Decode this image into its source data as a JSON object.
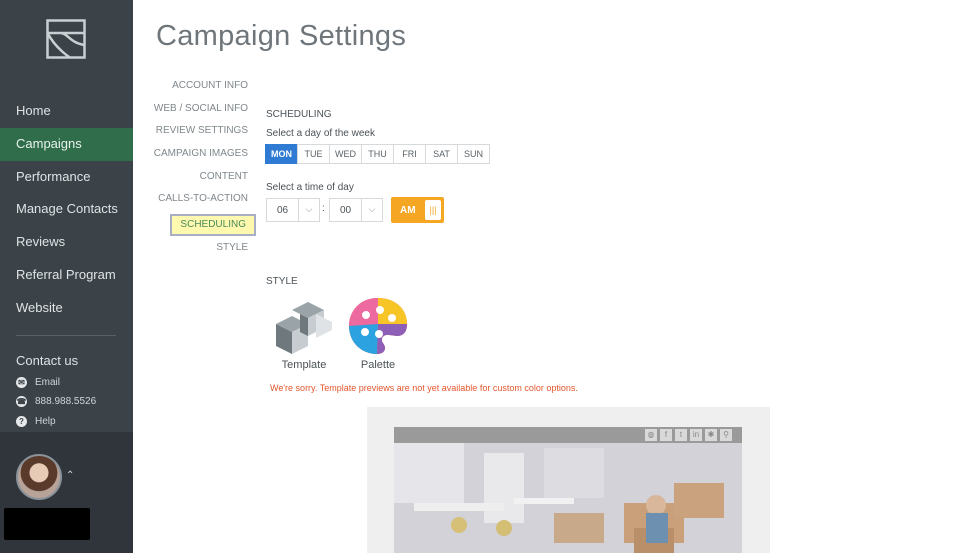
{
  "sidebar": {
    "nav": [
      {
        "label": "Home",
        "active": false
      },
      {
        "label": "Campaigns",
        "active": true
      },
      {
        "label": "Performance",
        "active": false
      },
      {
        "label": "Manage Contacts",
        "active": false
      },
      {
        "label": "Reviews",
        "active": false
      },
      {
        "label": "Referral Program",
        "active": false
      },
      {
        "label": "Website",
        "active": false
      }
    ],
    "contact_title": "Contact us",
    "email": "Email",
    "phone": "888.988.5526",
    "help": "Help"
  },
  "page": {
    "title": "Campaign Settings"
  },
  "subnav": [
    {
      "label": "ACCOUNT INFO"
    },
    {
      "label": "WEB / SOCIAL INFO"
    },
    {
      "label": "REVIEW SETTINGS"
    },
    {
      "label": "CAMPAIGN IMAGES"
    },
    {
      "label": "CONTENT"
    },
    {
      "label": "CALLS-TO-ACTION"
    },
    {
      "label": "SCHEDULING",
      "active": true
    },
    {
      "label": "STYLE"
    }
  ],
  "scheduling": {
    "heading": "SCHEDULING",
    "day_label": "Select a day of the week",
    "days": [
      "MON",
      "TUE",
      "WED",
      "THU",
      "FRI",
      "SAT",
      "SUN"
    ],
    "selected_day": "MON",
    "time_label": "Select a time of day",
    "hour": "06",
    "minute": "00",
    "separator": ":",
    "ampm": "AM"
  },
  "style": {
    "heading": "STYLE",
    "template_label": "Template",
    "palette_label": "Palette",
    "error": "We're sorry. Template previews are not yet available for custom color options."
  },
  "colors": {
    "sidebar_bg": "#3b4348",
    "active_nav": "#2f6d4b",
    "day_selected": "#2f7bd4",
    "ampm_toggle": "#f5a623",
    "error_text": "#e4572e"
  }
}
